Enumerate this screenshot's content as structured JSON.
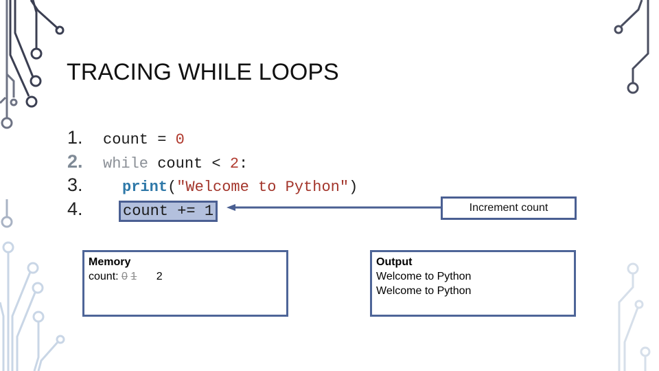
{
  "slide": {
    "title": "TRACING WHILE LOOPS"
  },
  "code": {
    "lines": [
      {
        "number": "1.",
        "parts": {
          "a": "count = ",
          "b": "0"
        }
      },
      {
        "number": "2.",
        "parts": {
          "a": "while",
          "b": " count < ",
          "c": "2",
          "d": ":"
        }
      },
      {
        "number": "3.",
        "parts": {
          "a": "print",
          "b": "(",
          "c": "\"Welcome to Python\"",
          "d": ")"
        }
      },
      {
        "number": "4.",
        "parts": {
          "a": "count += 1"
        }
      }
    ],
    "active_line": 2,
    "highlighted_line": 4
  },
  "annotation": {
    "label": "Increment count"
  },
  "memory": {
    "heading": "Memory",
    "variable": "count:",
    "old_values": [
      "0",
      "1"
    ],
    "current_value": "2"
  },
  "output": {
    "heading": "Output",
    "lines": [
      "Welcome to Python",
      "Welcome to Python"
    ]
  },
  "colors": {
    "accent": "#4a5f92",
    "highlight": "#b3c0dd",
    "number": "#b03a2e",
    "function": "#2e78a8"
  }
}
